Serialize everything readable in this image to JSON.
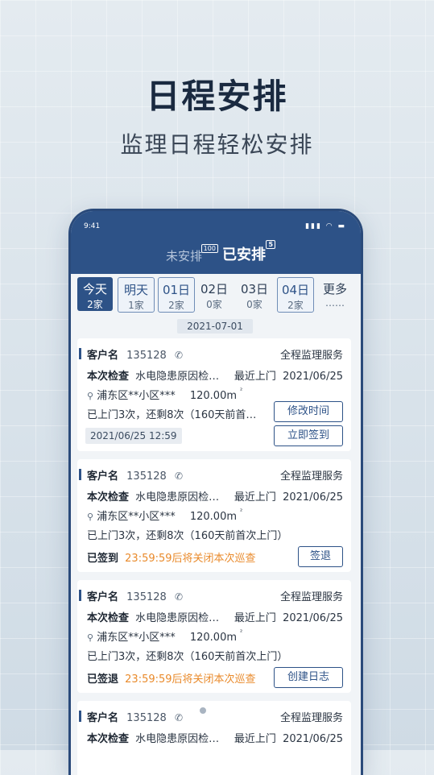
{
  "banner": {
    "title": "日程安排",
    "subtitle": "监理日程轻松安排"
  },
  "status": {
    "time": "9:41",
    "icons": "▮▮▮ ◠ ▬"
  },
  "tabs": {
    "unscheduled": {
      "label": "未安排",
      "badge": "100"
    },
    "scheduled": {
      "label": "已安排",
      "badge": "5"
    }
  },
  "days": [
    {
      "label": "今天",
      "count": "2家"
    },
    {
      "label": "明天",
      "count": "1家"
    },
    {
      "label": "01日",
      "count": "2家"
    },
    {
      "label": "02日",
      "count": "0家"
    },
    {
      "label": "03日",
      "count": "0家"
    },
    {
      "label": "04日",
      "count": "2家"
    },
    {
      "label": "更多",
      "count": "……"
    }
  ],
  "date_header": "2021-07-01",
  "cards": [
    {
      "customer_label": "客户名",
      "customer_id": "135128",
      "service": "全程监理服务",
      "check_label": "本次检查",
      "check_text": "水电隐患原因检…",
      "last_label": "最近上门",
      "last_date": "2021/06/25",
      "address": "浦东区**小区***",
      "area": "120.00m",
      "area_unit": "²",
      "visits": "已上门3次，还剩8次（160天前首…",
      "btn1": "修改时间",
      "time": "2021/06/25 12:59",
      "btn2": "立即签到"
    },
    {
      "customer_label": "客户名",
      "customer_id": "135128",
      "service": "全程监理服务",
      "check_label": "本次检查",
      "check_text": "水电隐患原因检…",
      "last_label": "最近上门",
      "last_date": "2021/06/25",
      "address": "浦东区**小区***",
      "area": "120.00m",
      "area_unit": "²",
      "visits": "已上门3次，还剩8次（160天前首次上门）",
      "status": "已签到",
      "notice": "23:59:59后将关闭本次巡查",
      "btn": "签退"
    },
    {
      "customer_label": "客户名",
      "customer_id": "135128",
      "service": "全程监理服务",
      "check_label": "本次检查",
      "check_text": "水电隐患原因检…",
      "last_label": "最近上门",
      "last_date": "2021/06/25",
      "address": "浦东区**小区***",
      "area": "120.00m",
      "area_unit": "²",
      "visits": "已上门3次，还剩8次（160天前首次上门）",
      "status": "已签退",
      "notice": "23:59:59后将关闭本次巡查",
      "btn": "创建日志"
    },
    {
      "customer_label": "客户名",
      "customer_id": "135128",
      "service": "全程监理服务",
      "check_label": "本次检查",
      "check_text": "水电隐患原因检…",
      "last_label": "最近上门",
      "last_date": "2021/06/25"
    }
  ]
}
